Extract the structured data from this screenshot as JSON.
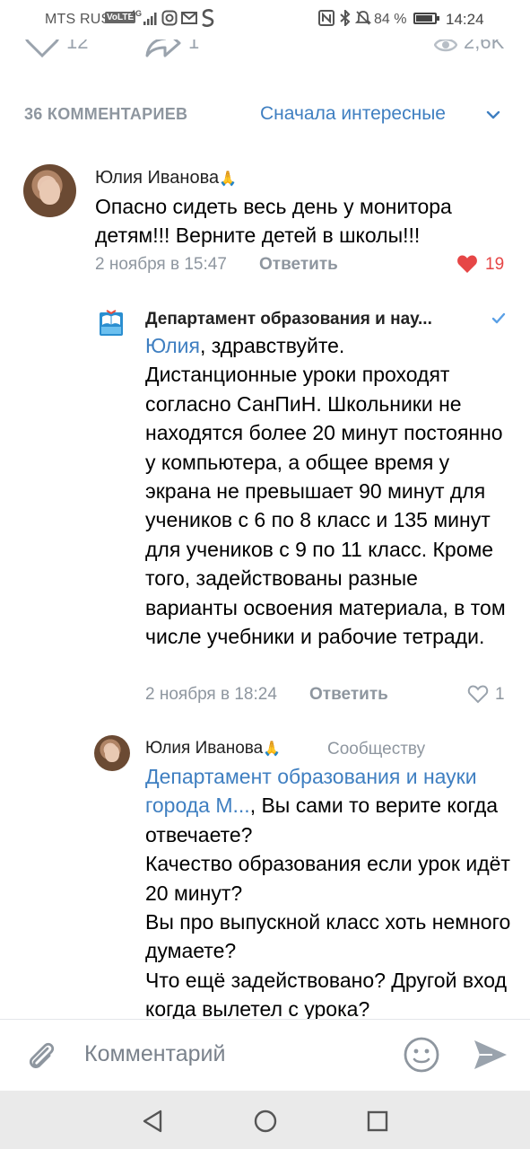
{
  "status_bar": {
    "carrier": "MTS RUS",
    "volte": "VoLTE",
    "network": "4G",
    "battery": "84 %",
    "battery_level": 0.84,
    "time": "14:24"
  },
  "post_actions": {
    "likes": "12",
    "shares": "1",
    "views": "2,6K"
  },
  "comments_header": {
    "count_label": "36 КОММЕНТАРИЕВ",
    "sort_label": "Сначала интересные"
  },
  "comments": [
    {
      "author": "Юлия Иванова",
      "author_emoji": "🙏",
      "text": "Опасно сидеть весь день у монитора детям!!! Верните детей в школы!!!",
      "date": "2 ноября в 15:47",
      "reply_label": "Ответить",
      "likes": "19",
      "liked": true
    },
    {
      "author": "Департамент образования и нау...",
      "verified": true,
      "mention": "Юлия",
      "text": ", здравствуйте.\nДистанционные уроки проходят согласно СанПиН. Школьники не находятся более 20 минут постоянно у компьютера, а общее время у экрана не превышает 90 минут для учеников с 6 по 8 класс и 135 минут для учеников с 9 по 11 класс. Кроме того, задействованы разные варианты освоения материала, в том числе учебники и рабочие тетради.",
      "date": "2 ноября в 18:24",
      "reply_label": "Ответить",
      "likes": "1",
      "liked": false
    },
    {
      "author": "Юлия Иванова",
      "author_emoji": "🙏",
      "reply_to": "Сообществу",
      "mention": "Департамент образования и науки города М...",
      "text": ", Вы сами то верите когда отвечаете?\nКачество образования если урок идёт 20 минут?\nВы про выпускной класс хоть немного думаете?\nЧто ещё задействовано? Другой вход когда вылетел с урока?"
    }
  ],
  "input_bar": {
    "placeholder": "Комментарий"
  },
  "icons": {
    "attach": "paperclip-icon",
    "emoji": "smile-icon",
    "send": "send-icon",
    "like": "heart-icon",
    "share": "share-icon",
    "views": "eye-icon"
  },
  "colors": {
    "link": "#3f7fc1",
    "secondary_text": "#8e969f",
    "like_red": "#e64646",
    "navbar_bg": "#eaeaea"
  }
}
